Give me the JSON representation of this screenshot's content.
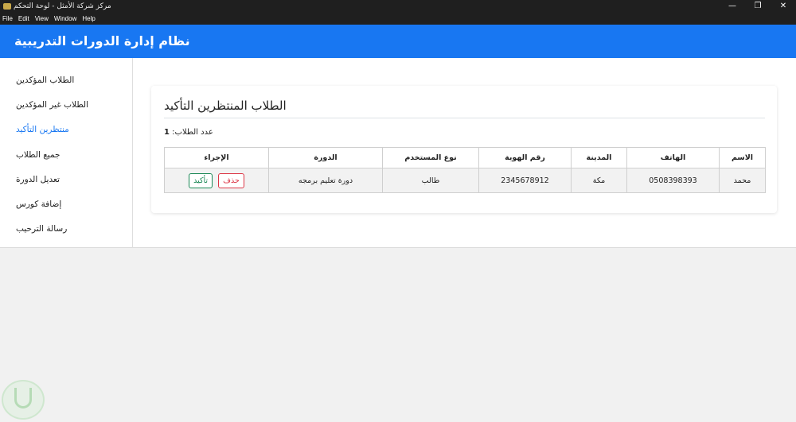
{
  "window": {
    "title": "مركز شركة الأمثل - لوحة التحكم",
    "controls": {
      "minimize": "—",
      "maximize": "❐",
      "close": "✕"
    }
  },
  "menubar": [
    "File",
    "Edit",
    "View",
    "Window",
    "Help"
  ],
  "app": {
    "title": "نظام إدارة الدورات التدريبية",
    "accent_color": "#1877f2"
  },
  "sidebar": {
    "items": [
      {
        "label": "الطلاب المؤكدين",
        "active": false
      },
      {
        "label": "الطلاب غير المؤكدين",
        "active": false
      },
      {
        "label": "منتظرين التأكيد",
        "active": true
      },
      {
        "label": "جميع الطلاب",
        "active": false
      },
      {
        "label": "تعديل الدورة",
        "active": false
      },
      {
        "label": "إضافة كورس",
        "active": false
      },
      {
        "label": "رسالة الترحيب",
        "active": false
      }
    ]
  },
  "main": {
    "title": "الطلاب المنتظرين التأكيد",
    "count_label": "عدد الطلاب:",
    "count_value": "1",
    "table": {
      "headers": [
        "الإجراء",
        "الدورة",
        "نوع المستخدم",
        "رقم الهوية",
        "المدينة",
        "الهاتف",
        "الاسم"
      ],
      "rows": [
        {
          "actions": {
            "delete": "حذف",
            "confirm": "تأكيد"
          },
          "course": "دورة تعليم برمجه",
          "user_type": "طالب",
          "id_number": "2345678912",
          "city": "مكة",
          "phone": "0508398393",
          "name": "محمد"
        }
      ]
    }
  },
  "colors": {
    "delete": "#dc3545",
    "confirm": "#198754"
  }
}
